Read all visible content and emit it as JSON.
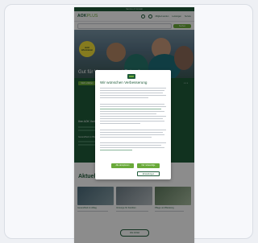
{
  "site": {
    "topbar_text": "Service & Kontakt",
    "logo_bold": "AOK",
    "logo_plain": "PLUS",
    "nav_items": [
      "Mitglied werden",
      "Leistungen",
      "Service"
    ],
    "search_button": "Suchen"
  },
  "hero": {
    "badge_text": "Jetzt informieren",
    "title": "Gut für Vorsorge und Zukunft"
  },
  "band": {
    "button": "Mehr erfahren",
    "dots": "•••",
    "heading": "Ihre AOK Vorteile",
    "subheading": "Gesundheit im Blick"
  },
  "section": {
    "title": "Aktuelles",
    "more_button": "Alle Artikel"
  },
  "tiles": [
    {
      "caption": "Gesundheit im Alltag"
    },
    {
      "caption": "Vorsorge für Familien"
    },
    {
      "caption": "Pflege und Beratung"
    }
  ],
  "modal": {
    "title": "Wir wünschen Verbesserung",
    "accept_button": "Alle akzeptieren",
    "settings_button": "Einstellungen",
    "reject_button": "Nur notwendige"
  },
  "colors": {
    "brand_green": "#1f5b3a",
    "accent_green": "#6aaa3a",
    "badge_yellow": "#f2e03a"
  }
}
